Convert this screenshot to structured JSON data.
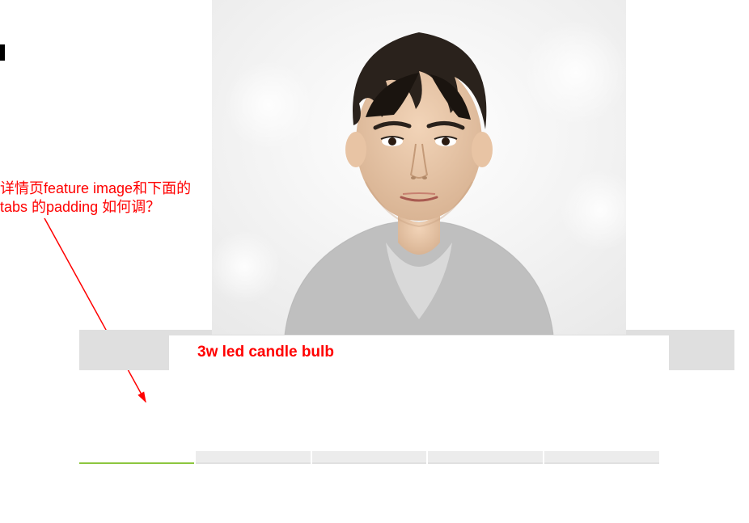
{
  "annotation": {
    "line1": "详情页feature image和下面的",
    "line2": "tabs 的padding 如何调？"
  },
  "feature": {
    "caption": "3w led candle bulb"
  },
  "tabs": {
    "items": [
      {
        "active": true
      },
      {
        "active": false
      },
      {
        "active": false
      },
      {
        "active": false
      },
      {
        "active": false
      }
    ]
  }
}
